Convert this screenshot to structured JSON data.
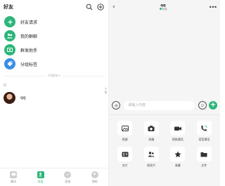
{
  "contacts": {
    "title": "好友",
    "menu": [
      {
        "label": "好友请求",
        "icon": "add-friend-icon"
      },
      {
        "label": "我的群聊",
        "icon": "group-chat-icon"
      },
      {
        "label": "群发助手",
        "icon": "broadcast-icon"
      },
      {
        "label": "分组标签",
        "icon": "tag-icon"
      }
    ],
    "divider_label": "1位联系人",
    "section_letter": "Q",
    "index_letters": [
      "↑",
      "Q"
    ],
    "friends": [
      {
        "name": "qq"
      }
    ]
  },
  "tabs": [
    {
      "label": "聊天",
      "active": false,
      "icon": "chat-icon"
    },
    {
      "label": "好友",
      "active": true,
      "icon": "contacts-icon"
    },
    {
      "label": "发现",
      "active": false,
      "icon": "discover-icon"
    },
    {
      "label": "我的",
      "active": false,
      "icon": "profile-icon"
    }
  ],
  "chat": {
    "name": "qq",
    "status": "在线",
    "input_placeholder": "请输入内容",
    "actions": [
      {
        "label": "相册",
        "icon": "album-icon"
      },
      {
        "label": "拍摄",
        "icon": "camera-icon"
      },
      {
        "label": "视频通话",
        "icon": "video-call-icon"
      },
      {
        "label": "语音通话",
        "icon": "voice-call-icon"
      },
      {
        "label": "名片",
        "icon": "business-card-icon"
      },
      {
        "label": "群发片",
        "icon": "group-card-icon"
      },
      {
        "label": "收藏",
        "icon": "favorite-icon"
      },
      {
        "label": "文件",
        "icon": "file-icon"
      }
    ]
  },
  "colors": {
    "accent": "#2cb57a",
    "panel_bg": "#f5f5f5"
  }
}
